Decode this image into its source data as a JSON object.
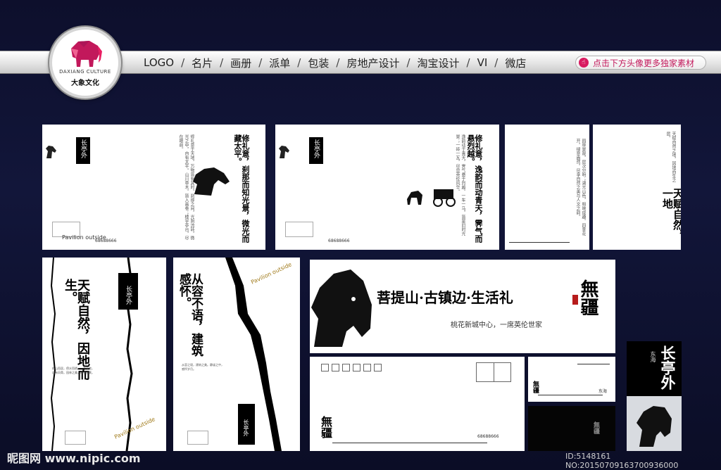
{
  "logo": {
    "en": "DAXIANG CULTURE",
    "cn": "大象文化"
  },
  "nav": {
    "items": [
      "LOGO",
      "名片",
      "画册",
      "派单",
      "包装",
      "房地产设计",
      "淘宝设计",
      "VI",
      "微店"
    ],
    "separator": "/"
  },
  "promo": {
    "label": "点击下方头像更多独家素材"
  },
  "brand": {
    "name": "长亭外",
    "pavilion": "Pavilion outside",
    "wu": "無疆"
  },
  "card1": {
    "title": "修礼意，刹那而知光景，微光而藏太平。",
    "phone": "68688666"
  },
  "card2": {
    "title": "修礼意，逸韵而动青天，霁气而悬烈越。",
    "phone": "68688666"
  },
  "card_tall1": {
    "title": "天赋自然，因地而生。"
  },
  "card_tall2": {
    "title": "从容不语，建筑感怀。"
  },
  "banner": {
    "headline": "菩提山·古镇边·生活礼",
    "sub": "桃花新城中心，一席英伦世家"
  },
  "card_side": {
    "title": "天赋自然，一地"
  },
  "envelope": {
    "phone": "68688666"
  },
  "card_small": {
    "region": "东海"
  },
  "card_portrait": {
    "region": "东海"
  },
  "watermark": {
    "site": "昵图网 www.nipic.com",
    "id": "ID:5148161 NO:20150709163700936000"
  }
}
